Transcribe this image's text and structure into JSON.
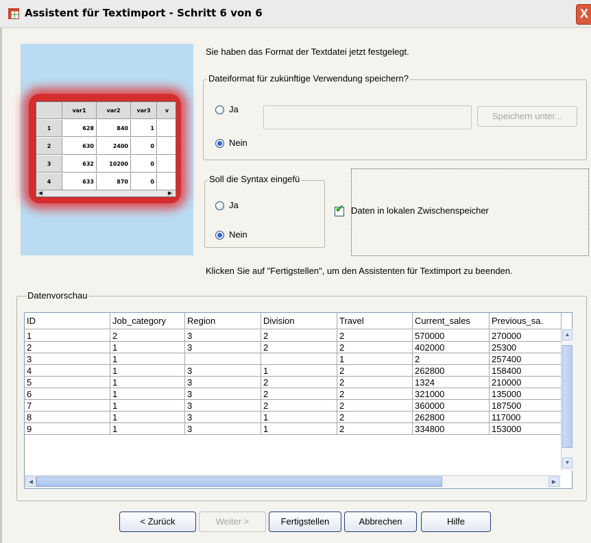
{
  "window": {
    "title": "Assistent für Textimport - Schritt 6 von 6",
    "close_label": "X"
  },
  "preview_image": {
    "headers": [
      "",
      "var1",
      "var2",
      "var3",
      "v"
    ],
    "rows": [
      [
        "1",
        "628",
        "840",
        "1",
        ""
      ],
      [
        "2",
        "630",
        "2400",
        "0",
        ""
      ],
      [
        "3",
        "632",
        "10200",
        "0",
        ""
      ],
      [
        "4",
        "633",
        "870",
        "0",
        ""
      ]
    ],
    "scroll_left": "◀",
    "scroll_right": "▶"
  },
  "intro_text": "Sie haben das Format der Textdatei jetzt festgelegt.",
  "save_group": {
    "title": "Dateiformat für zukünftige Verwendung speichern?",
    "yes_label": "Ja",
    "no_label": "Nein",
    "save_button": "Speichern unter...",
    "selected": "Nein"
  },
  "syntax_group": {
    "title": "Soll die Syntax eingefü",
    "yes_label": "Ja",
    "no_label": "Nein",
    "selected": "Nein"
  },
  "cache_checkbox": {
    "label": "Daten in lokalen Zwischenspeicher",
    "checked": true,
    "mark": "✔"
  },
  "finish_hint": "Klicken Sie auf \"Fertigstellen\", um den Assistenten für Textimport zu beenden.",
  "data_preview": {
    "title": "Datenvorschau",
    "columns": [
      "ID",
      "Job_category",
      "Region",
      "Division",
      "Travel",
      "Current_sales",
      "Previous_sa."
    ],
    "rows": [
      [
        "1",
        "2",
        "3",
        "2",
        "2",
        "570000",
        "270000"
      ],
      [
        "2",
        "1",
        "3",
        "2",
        "2",
        "402000",
        "25300"
      ],
      [
        "3",
        "1",
        "",
        "",
        "1",
        "2",
        "257400"
      ],
      [
        "4",
        "1",
        "3",
        "1",
        "2",
        "262800",
        "158400"
      ],
      [
        "5",
        "1",
        "3",
        "2",
        "2",
        "1324",
        "210000"
      ],
      [
        "6",
        "1",
        "3",
        "2",
        "2",
        "321000",
        "135000"
      ],
      [
        "7",
        "1",
        "3",
        "2",
        "2",
        "360000",
        "187500"
      ],
      [
        "8",
        "1",
        "3",
        "1",
        "2",
        "262800",
        "117000"
      ],
      [
        "9",
        "1",
        "3",
        "1",
        "2",
        "334800",
        "153000"
      ]
    ],
    "scroll_up": "▲",
    "scroll_down": "▼",
    "scroll_left": "◀",
    "scroll_right": "▶"
  },
  "buttons": {
    "back": "< Zurück",
    "next": "Weiter >",
    "finish": "Fertigstellen",
    "cancel": "Abbrechen",
    "help": "Hilfe"
  }
}
